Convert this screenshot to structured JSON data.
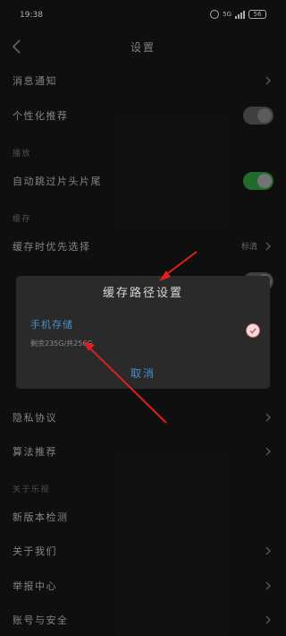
{
  "status_bar": {
    "time": "19:38",
    "network": "5G",
    "battery": "56"
  },
  "header": {
    "title": "设置"
  },
  "rows": {
    "msg_notify": "消息通知",
    "personalized": "个性化推荐",
    "section_play": "播放",
    "auto_skip": "自动跳过片头片尾",
    "section_cache": "缓存",
    "cache_priority": "缓存时优先选择",
    "cache_priority_value": "标清",
    "privacy": "隐私协议",
    "algorithm": "算法推荐",
    "section_about": "关于乐视",
    "version_check": "新版本检测",
    "about_us": "关于我们",
    "report": "举报中心",
    "account_security": "账号与安全"
  },
  "toggles": {
    "personalized": false,
    "auto_skip": true
  },
  "dialog": {
    "title": "缓存路径设置",
    "option_name": "手机存储",
    "option_detail": "剩余235G/共256G",
    "cancel": "取消"
  },
  "colors": {
    "accent_blue": "#4a8ec8",
    "toggle_on": "#2d8f3f",
    "annotation_red": "#e02020"
  }
}
